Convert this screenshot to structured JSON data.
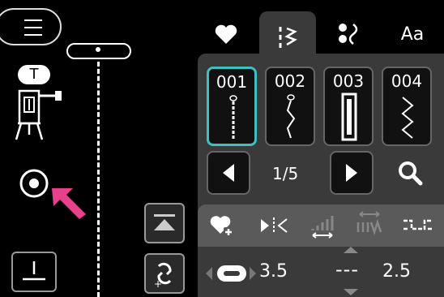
{
  "tabs": [
    {
      "label": "",
      "icon": "heart-icon"
    },
    {
      "label": "",
      "icon": "stitch-list-icon"
    },
    {
      "label": "",
      "icon": "decorative-stitch-icon"
    },
    {
      "label": "Aa",
      "icon": "alphabet-icon"
    }
  ],
  "presser_foot": {
    "label": "T"
  },
  "stitches": [
    {
      "number": "001"
    },
    {
      "number": "002"
    },
    {
      "number": "003"
    },
    {
      "number": "004"
    }
  ],
  "pagination": {
    "page": "1/5"
  },
  "settings": {
    "stitch_length": "3.5",
    "stitch_width_placeholder": "---",
    "stitch_width": "2.5"
  },
  "colors": {
    "accent": "#3fbfbf",
    "arrow": "#e8418c"
  }
}
